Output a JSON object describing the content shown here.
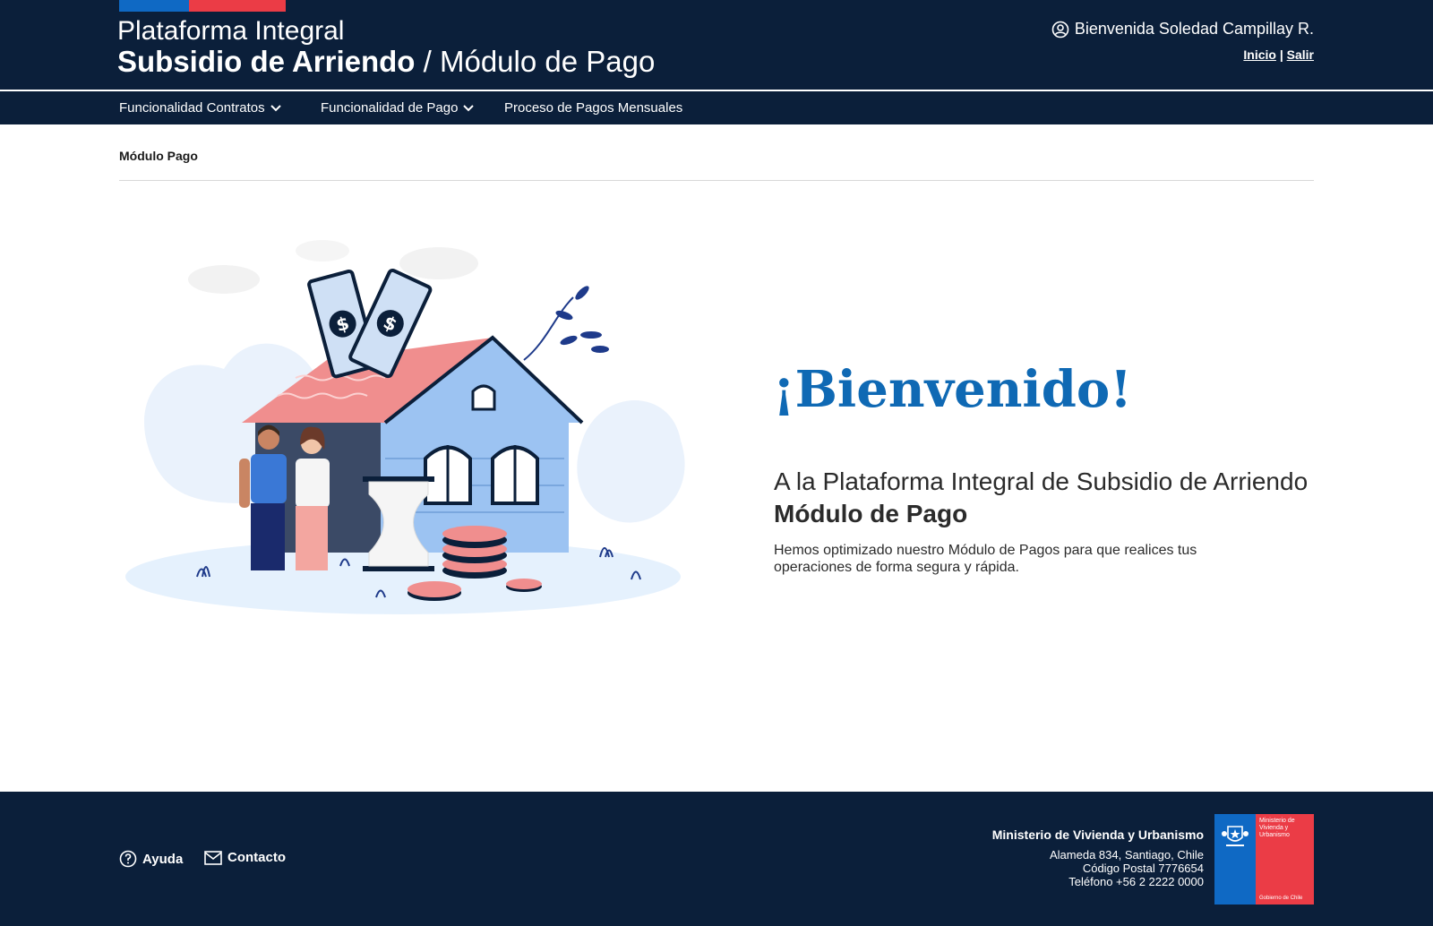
{
  "header": {
    "title_line1": "Plataforma Integral",
    "title_strong": "Subsidio de Arriendo",
    "title_light": " / Módulo de Pago",
    "user_greeting": "Bienvenida Soledad Campillay R.",
    "link_inicio": "Inicio",
    "link_separator": "|",
    "link_salir": "Salir"
  },
  "nav": {
    "items": [
      {
        "label": "Funcionalidad Contratos"
      },
      {
        "label": "Funcionalidad de Pago"
      },
      {
        "label": "Proceso de Pagos Mensuales"
      }
    ]
  },
  "breadcrumb": "Módulo Pago",
  "main": {
    "welcome_title": "¡Bienvenido!",
    "subtitle": "A la Plataforma Integral de Subsidio de Arriendo",
    "subtitle_strong": "Módulo de Pago",
    "description": "Hemos optimizado nuestro Módulo de Pagos para que realices tus operaciones de forma segura y rápida."
  },
  "footer": {
    "help_label": "Ayuda",
    "contact_label": "Contacto",
    "ministry_name": "Ministerio de Vivienda y Urbanismo",
    "address_line1": "Alameda 834, Santiago, Chile",
    "address_line2": "Código Postal 7776654",
    "address_line3": "Teléfono +56 2 2222 0000",
    "logo_text": "Ministerio de Vivienda y Urbanismo",
    "logo_sub": "Gobierno de Chile"
  },
  "colors": {
    "navy": "#0b1f3a",
    "accent_blue": "#0f69b4",
    "flag_blue": "#0f69c4",
    "flag_red": "#eb3c46"
  }
}
